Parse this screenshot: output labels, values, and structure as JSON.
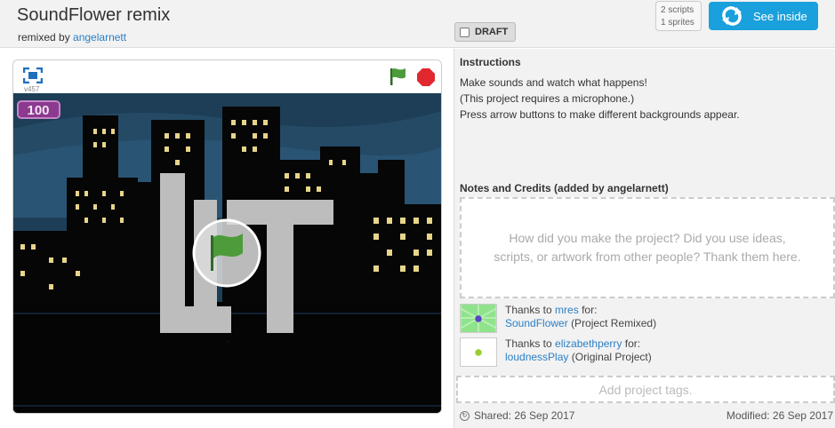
{
  "header": {
    "title": "SoundFlower remix",
    "remixed_prefix": "remixed by",
    "remixed_user": "angelarnett",
    "draft_label": "DRAFT",
    "scripts_count": "2 scripts",
    "sprites_count": "1 sprites",
    "see_inside_label": "See inside"
  },
  "player": {
    "version": "v457",
    "counter_value": "100",
    "stage_text": "LIT"
  },
  "instructions": {
    "title": "Instructions",
    "lines": [
      "Make sounds and watch what happens!",
      "(This project requires a microphone.)",
      "Press arrow buttons to make different backgrounds appear."
    ]
  },
  "notes": {
    "title": "Notes and Credits (added by angelarnett)",
    "placeholder": "How did you make the project? Did you use ideas, scripts, or artwork from other people? Thank them here."
  },
  "credits": [
    {
      "thanks": "Thanks to",
      "user": "mres",
      "for": "for:",
      "project": "SoundFlower",
      "kind": "(Project Remixed)"
    },
    {
      "thanks": "Thanks to",
      "user": "elizabethperry",
      "for": "for:",
      "project": "loudnessPlay",
      "kind": "(Original Project)"
    }
  ],
  "tags_placeholder": "Add project tags.",
  "footer": {
    "shared": "Shared: 26 Sep 2017",
    "modified": "Modified: 26 Sep 2017"
  },
  "colors": {
    "accent": "#1aa0dc",
    "link": "#2b7fc6",
    "flag": "#4d9b3a",
    "stop": "#e0282e",
    "sky": "#1d3e56",
    "building": "#060606",
    "window": "#e7d58a"
  }
}
